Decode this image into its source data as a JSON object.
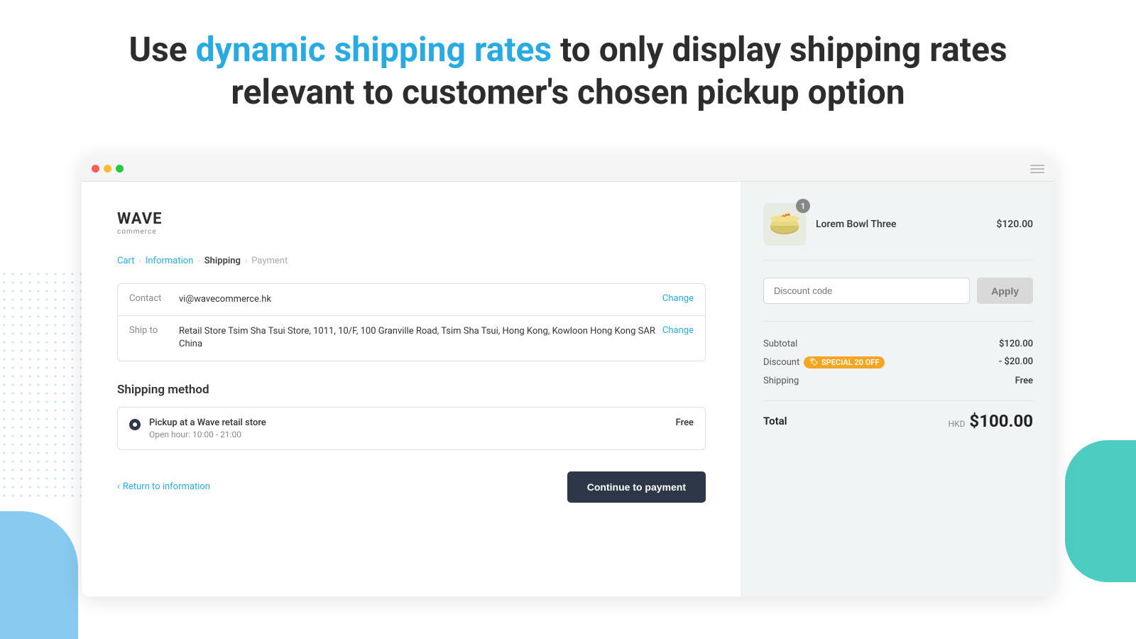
{
  "header": {
    "line1_normal_before": "Use ",
    "line1_highlight": "dynamic shipping rates",
    "line1_normal_after": " to only display shipping rates",
    "line2": "relevant to customer's chosen pickup option"
  },
  "browser": {
    "dots": [
      "red",
      "yellow",
      "green"
    ]
  },
  "logo": {
    "name": "WAVE",
    "sub": "commerce"
  },
  "breadcrumb": {
    "items": [
      "Cart",
      "Information",
      "Shipping",
      "Payment"
    ],
    "active": "Shipping"
  },
  "info_rows": [
    {
      "label": "Contact",
      "value": "vi@wavecommerce.hk",
      "change": "Change"
    },
    {
      "label": "Ship to",
      "value": "Retail Store Tsim Sha Tsui Store, 1011, 10/F, 100 Granville Road, Tsim Sha Tsui, Hong Kong, Kowloon Hong Kong SAR China",
      "change": "Change"
    }
  ],
  "shipping": {
    "section_title": "Shipping method",
    "option": {
      "name": "Pickup at a Wave retail store",
      "hours": "Open hour: 10:00 - 21:00",
      "price": "Free"
    }
  },
  "actions": {
    "return_label": "Return to information",
    "continue_label": "Continue to payment"
  },
  "order_summary": {
    "product": {
      "name": "Lorem Bowl Three",
      "price": "$120.00",
      "quantity": "1"
    },
    "discount_placeholder": "Discount code",
    "apply_label": "Apply",
    "subtotal_label": "Subtotal",
    "subtotal_value": "$120.00",
    "discount_label": "Discount",
    "discount_code": "SPECIAL 20 OFF",
    "discount_value": "- $20.00",
    "shipping_label": "Shipping",
    "shipping_value": "Free",
    "total_label": "Total",
    "total_currency": "HKD",
    "total_amount": "$100.00"
  }
}
